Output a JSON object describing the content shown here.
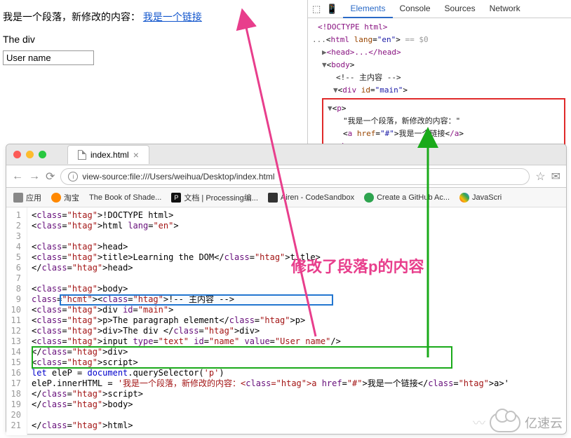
{
  "rendered": {
    "paragraph_text": "我是一个段落，新修改的内容：",
    "link_text": "我是一个链接",
    "div_text": "The div",
    "input_value": "User name"
  },
  "devtools": {
    "tabs": [
      "Elements",
      "Console",
      "Sources",
      "Network"
    ],
    "doctype": "<!DOCTYPE html>",
    "html_open": "html",
    "lang_attr": "lang",
    "lang_val": "\"en\"",
    "eq0": "== $0",
    "head": "<head>...</head>",
    "body": "body",
    "comment": "<!-- 主内容 -->",
    "div_main": "div",
    "id_attr": "id",
    "id_val": "\"main\"",
    "p_tag": "p",
    "p_text": "\"我是一个段落，新修改的内容：\"",
    "a_tag": "a",
    "href_attr": "href",
    "href_val": "\"#\"",
    "a_text": "我是一个链接",
    "a_close": "/a",
    "p_close": "/p"
  },
  "browser": {
    "tab_title": "index.html",
    "url": "view-source:file:///Users/weihua/Desktop/index.html",
    "bookmarks": [
      "应用",
      "淘宝",
      "The Book of Shade...",
      "文档 | Processing编...",
      "Airen - CodeSandbox",
      "Create a GitHub Ac...",
      "JavaScri"
    ]
  },
  "source": {
    "lines": [
      "<!DOCTYPE html>",
      "<html lang=\"en\">",
      "",
      "  <head>",
      "    <title>Learning the DOM</title>",
      "  </head>",
      "",
      "  <body>",
      "    <!-- 主内容 -->",
      "    <div id=\"main\">",
      "      <p>The paragraph element</p>",
      "      <div>The div </div>",
      "      <input type=\"text\" id=\"name\" value=\"User name\"/>",
      "    </div>",
      "  <script>",
      "    let eleP = document.querySelector('p')",
      "    eleP.innerHTML = '我是一个段落，新修改的内容：<a href=\"#\">我是一个链接</a>'",
      "  </scr__ipt>",
      "  </body>",
      "",
      "</html>"
    ]
  },
  "annotation": "修改了段落p的内容",
  "watermark": "亿速云"
}
